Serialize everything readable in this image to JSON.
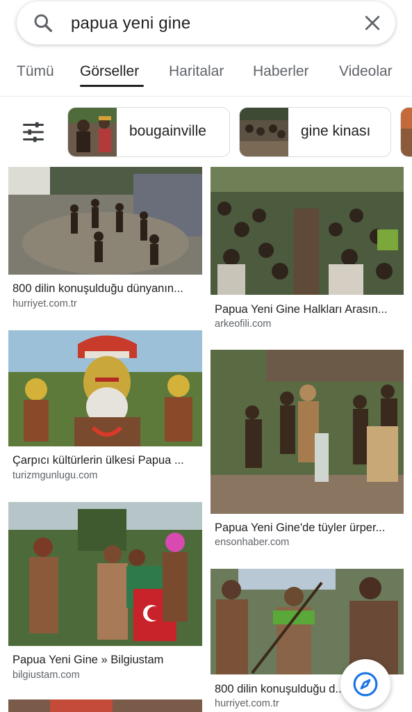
{
  "search": {
    "query": "papua yeni gine"
  },
  "tabs": [
    "Tümü",
    "Görseller",
    "Haritalar",
    "Haberler",
    "Videolar"
  ],
  "active_tab": "Görseller",
  "chips": [
    {
      "label": "bougainville"
    },
    {
      "label": "gine kinası"
    }
  ],
  "results": [
    {
      "title": "800 dilin konuşulduğu dünyanın...",
      "source": "hurriyet.com.tr"
    },
    {
      "title": "Papua Yeni Gine Halkları Arasın...",
      "source": "arkeofili.com"
    },
    {
      "title": "Çarpıcı kültürlerin ülkesi Papua ...",
      "source": "turizmgunlugu.com"
    },
    {
      "title": "Papua Yeni Gine'de tüyler ürper...",
      "source": "ensonhaber.com"
    },
    {
      "title": "Papua Yeni Gine » Bilgiustam",
      "source": "bilgiustam.com"
    },
    {
      "title": "800 dilin konuşulduğu d...",
      "source": "hurriyet.com.tr"
    }
  ],
  "icons": {
    "search": "search-icon",
    "clear": "close-icon",
    "filter": "tune-icon",
    "fab": "compass-icon"
  },
  "colors": {
    "accent": "#1a73e8",
    "text_primary": "#202124",
    "text_secondary": "#5f6368"
  }
}
